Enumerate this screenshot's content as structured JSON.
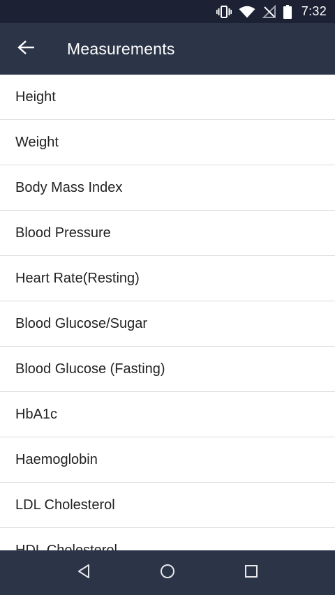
{
  "status_bar": {
    "time": "7:32",
    "icons": [
      "vibrate-icon",
      "wifi-icon",
      "no-signal-icon",
      "battery-icon"
    ]
  },
  "app_bar": {
    "title": "Measurements",
    "back_icon": "back-arrow-icon"
  },
  "measurements": {
    "items": [
      {
        "label": "Height"
      },
      {
        "label": "Weight"
      },
      {
        "label": "Body Mass Index"
      },
      {
        "label": "Blood Pressure"
      },
      {
        "label": "Heart Rate(Resting)"
      },
      {
        "label": "Blood Glucose/Sugar"
      },
      {
        "label": "Blood Glucose (Fasting)"
      },
      {
        "label": "HbA1c"
      },
      {
        "label": "Haemoglobin"
      },
      {
        "label": "LDL Cholesterol"
      },
      {
        "label": "HDL Cholesterol"
      }
    ]
  },
  "nav_bar": {
    "buttons": [
      "nav-back-icon",
      "nav-home-icon",
      "nav-recents-icon"
    ]
  },
  "colors": {
    "status_bar_bg": "#1c2233",
    "app_bar_bg": "#2c3447",
    "divider": "#dcdcdc",
    "text": "#222222"
  }
}
